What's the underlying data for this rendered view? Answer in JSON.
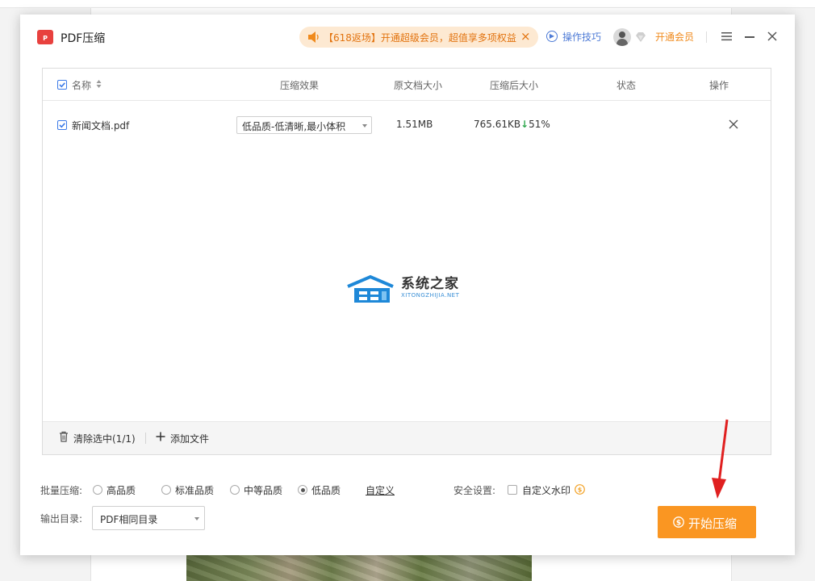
{
  "app": {
    "title": "PDF压缩"
  },
  "promo": {
    "text": "【618返场】开通超级会员，超值享多项权益",
    "close": "×"
  },
  "header": {
    "tips_label": "操作技巧",
    "vip_label": "开通会员"
  },
  "table": {
    "columns": {
      "name": "名称",
      "effect": "压缩效果",
      "original_size": "原文档大小",
      "compressed_size": "压缩后大小",
      "status": "状态",
      "action": "操作"
    },
    "rows": [
      {
        "name": "新闻文档.pdf",
        "effect": "低品质-低清晰,最小体积",
        "original_size": "1.51MB",
        "compressed_size": "765.61KB",
        "ratio_arrow": "↓",
        "ratio": "51%",
        "status": ""
      }
    ]
  },
  "watermark": {
    "name": "系统之家",
    "domain": "XITONGZHIJIA.NET"
  },
  "footer_bar": {
    "clear_label": "清除选中(1/1)",
    "add_label": "添加文件"
  },
  "settings": {
    "batch_label": "批量压缩:",
    "options": [
      {
        "label": "高品质",
        "selected": false
      },
      {
        "label": "标准品质",
        "selected": false
      },
      {
        "label": "中等品质",
        "selected": false
      },
      {
        "label": "低品质",
        "selected": true
      }
    ],
    "custom_label": "自定义",
    "security_label": "安全设置:",
    "watermark_label": "自定义水印",
    "output_label": "输出目录:",
    "output_value": "PDF相同目录"
  },
  "start_button": {
    "label": "开始压缩"
  },
  "colors": {
    "accent_orange": "#fa9622",
    "link_blue": "#4e7bd6",
    "check_blue": "#3d7be8",
    "promo_text": "#e2730f",
    "annotation_red": "#e02020"
  }
}
